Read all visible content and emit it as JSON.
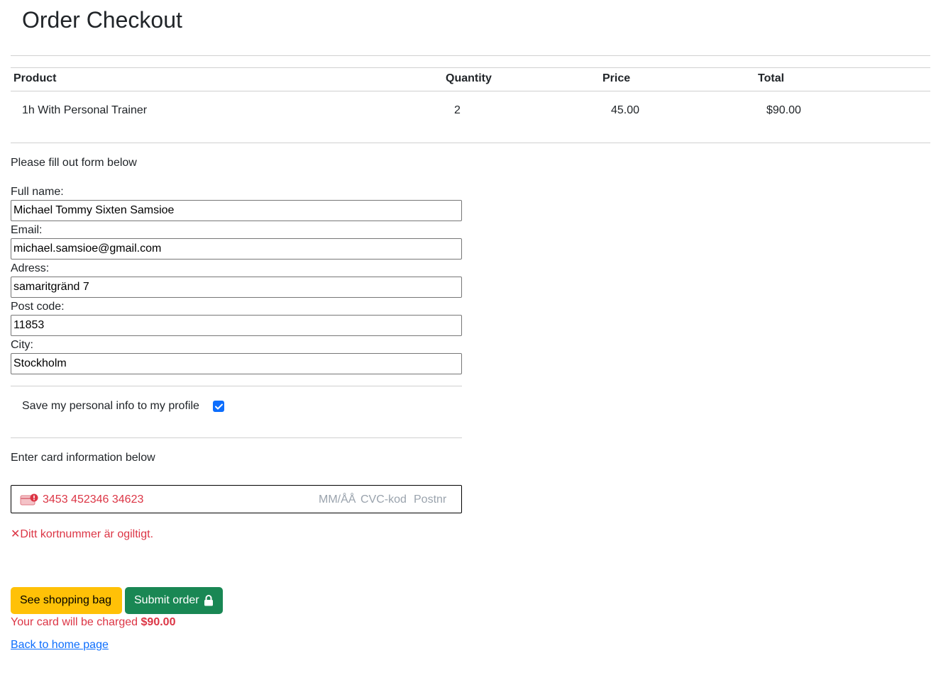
{
  "page": {
    "title": "Order Checkout"
  },
  "table": {
    "headers": [
      "Product",
      "Quantity",
      "Price",
      "Total"
    ],
    "rows": [
      {
        "product": "1h With Personal Trainer",
        "quantity": "2",
        "price": "45.00",
        "total": "$90.00"
      }
    ]
  },
  "form": {
    "intro": "Please fill out form below",
    "fields": [
      {
        "label": "Full name:",
        "value": "Michael Tommy Sixten Samsioe"
      },
      {
        "label": "Email:",
        "value": "michael.samsioe@gmail.com"
      },
      {
        "label": "Adress:",
        "value": "samaritgränd 7"
      },
      {
        "label": "Post code:",
        "value": "11853"
      },
      {
        "label": "City:",
        "value": "Stockholm"
      }
    ],
    "save_info_label": "Save my personal info to my profile",
    "save_info_checked": true
  },
  "card": {
    "intro": "Enter card information below",
    "number": "3453 452346 34623",
    "expiry_placeholder": "MM/ÅÅ",
    "cvc_placeholder": "CVC-kod",
    "postal_placeholder": "Postnr",
    "error_icon": "✕",
    "error": "Ditt kortnummer är ogiltigt."
  },
  "actions": {
    "see_bag": "See shopping bag",
    "submit": "Submit order",
    "charge_prefix": "Your card will be charged",
    "charge_amount": "$90.00",
    "back_link": "Back to home page"
  },
  "colors": {
    "error": "#dc3545",
    "primary": "#0d6efd",
    "warning": "#ffc107",
    "success": "#198754"
  },
  "icons": {
    "card_error": "card-error-icon",
    "submit": "lock-icon",
    "checkbox": "check-icon"
  }
}
